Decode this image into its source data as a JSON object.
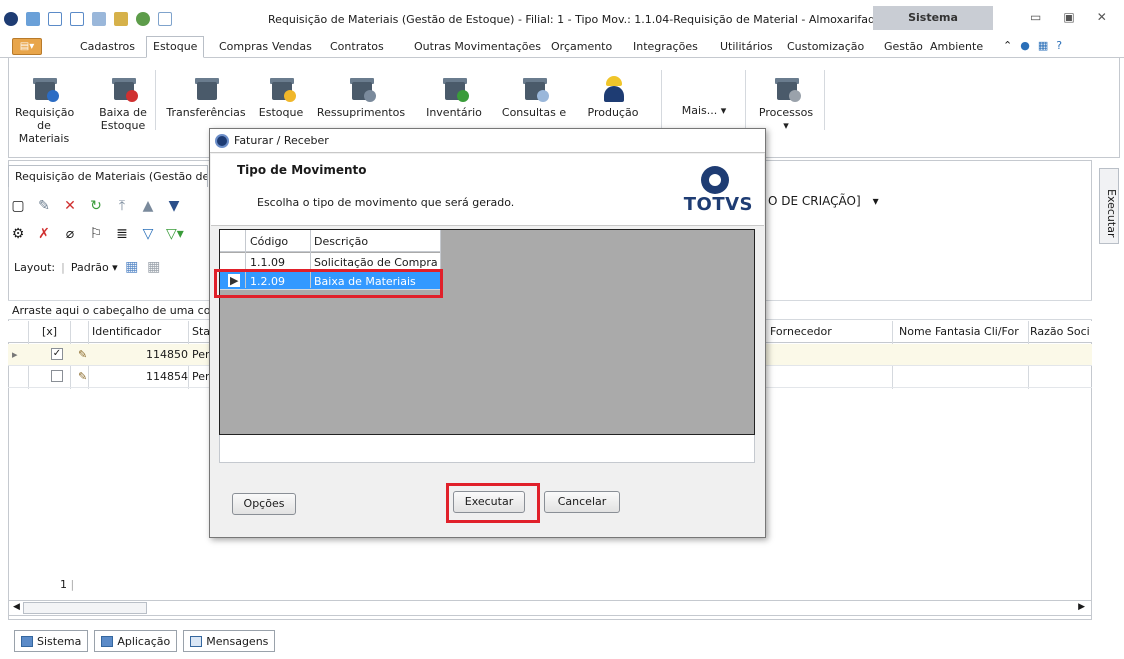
{
  "window": {
    "title": "Requisição de Materiais (Gestão de Estoque) - Filial: 1 - Tipo Mov.: 1.1.04-Requisição de Material - Almoxarifado ...",
    "sistema_tab": "Sistema"
  },
  "menu": {
    "items": [
      "Cadastros",
      "Estoque",
      "Compras",
      "Vendas",
      "Contratos",
      "Outras Movimentações",
      "Orçamento",
      "Integrações",
      "Utilitários",
      "Customização",
      "Gestão",
      "Ambiente"
    ],
    "active": "Estoque"
  },
  "ribbon": {
    "buttons": [
      {
        "label1": "Requisição",
        "label2": "de Materiais",
        "icon": "requisicao-icon"
      },
      {
        "label1": "Baixa de",
        "label2": "Estoque",
        "icon": "baixa-icon"
      },
      {
        "label1": "Transferências",
        "label2": "",
        "icon": "transfer-icon"
      },
      {
        "label1": "Estoque",
        "label2": "",
        "icon": "estoque-icon"
      },
      {
        "label1": "Ressuprimentos",
        "label2": "",
        "icon": "ressup-icon"
      },
      {
        "label1": "Inventário",
        "label2": "",
        "icon": "inventario-icon"
      },
      {
        "label1": "Consultas e",
        "label2": "",
        "icon": "consultas-icon"
      },
      {
        "label1": "Produção",
        "label2": "",
        "icon": "producao-icon"
      },
      {
        "label1": "Mais...",
        "label2": "",
        "icon": "mais-icon"
      },
      {
        "label1": "Processos",
        "label2": "",
        "icon": "processos-icon"
      }
    ]
  },
  "document": {
    "tab_label": "Requisição de Materiais (Gestão de",
    "filter_text": "O DE CRIAÇÃO]",
    "layout_label": "Layout:",
    "layout_value": "Padrão",
    "drag_hint": "Arraste aqui o cabeçalho de uma colu",
    "side_label": "Executar",
    "page_num": "1",
    "columns": {
      "check": "[x]",
      "identificador": "Identificador",
      "status": "Sta",
      "fornecedor": "Fornecedor",
      "nome_fantasia": "Nome Fantasia Cli/For",
      "razao": "Razão Soci"
    },
    "rows": [
      {
        "checked": "✓",
        "id": "114850",
        "status": "Per"
      },
      {
        "checked": "",
        "id": "114854",
        "status": "Per"
      }
    ]
  },
  "bottom_tabs": [
    "Sistema",
    "Aplicação",
    "Mensagens"
  ],
  "dialog": {
    "title": "Faturar / Receber",
    "heading": "Tipo de Movimento",
    "subtitle": "Escolha o tipo de movimento que será gerado.",
    "logo_text": "TOTVS",
    "col_codigo": "Código",
    "col_descricao": "Descrição",
    "rows": [
      {
        "codigo": "1.1.09",
        "descricao": "Solicitação de Compra"
      },
      {
        "codigo": "1.2.09",
        "descricao": "Baixa de Materiais"
      }
    ],
    "btn_opcoes": "Opções",
    "btn_executar": "Executar",
    "btn_cancelar": "Cancelar"
  },
  "colors": {
    "highlight": "#3399ff",
    "annotation_red": "#e0202a",
    "totvs_blue": "#1e3c73",
    "modal_grid_bg": "#aaaaaa"
  }
}
